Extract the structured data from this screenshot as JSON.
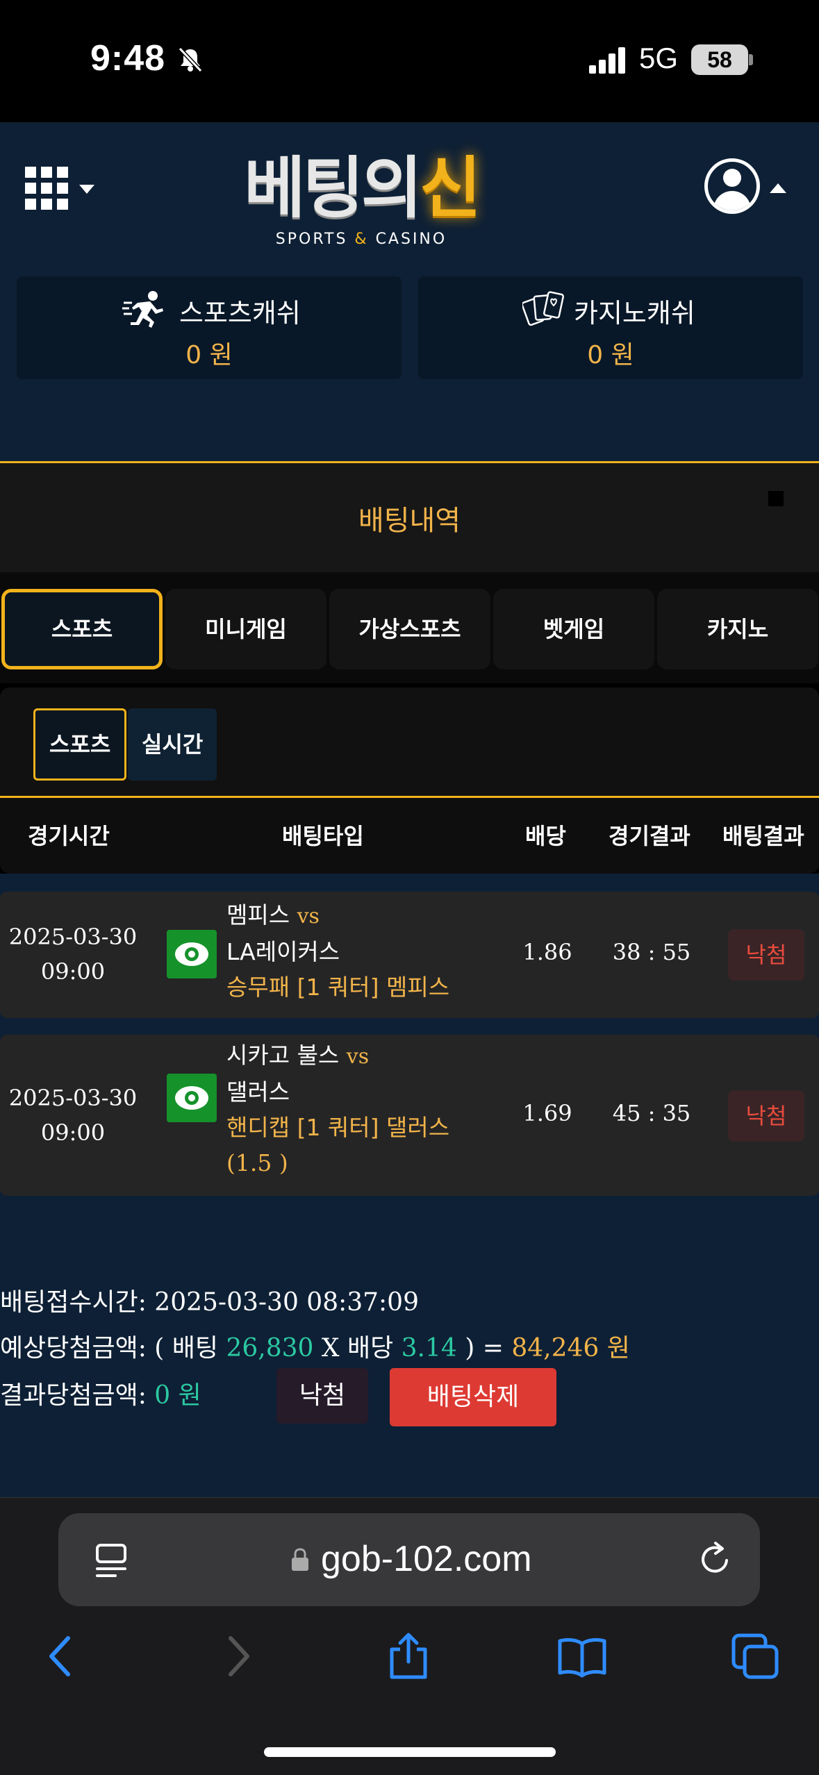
{
  "status_bar": {
    "time": "9:48",
    "network": "5G",
    "battery": "58"
  },
  "header": {
    "logo_main_white": "베팅의",
    "logo_main_gold": "신",
    "logo_sub_left": "SPORTS ",
    "logo_sub_amp": "&",
    "logo_sub_right": " CASINO"
  },
  "wallets": [
    {
      "label": "스포츠캐쉬",
      "value": "0 원",
      "icon": "sports-runner-icon"
    },
    {
      "label": "카지노캐쉬",
      "value": "0 원",
      "icon": "playing-cards-icon"
    }
  ],
  "page_title": "배팅내역",
  "categories": [
    "스포츠",
    "미니게임",
    "가상스포츠",
    "벳게임",
    "카지노"
  ],
  "active_category": "스포츠",
  "sub_tabs": [
    "스포츠",
    "실시간"
  ],
  "active_sub_tab": "스포츠",
  "table": {
    "headers": [
      "경기시간",
      "배팅타입",
      "배당",
      "경기결과",
      "배팅결과"
    ],
    "rows": [
      {
        "date": "2025-03-30",
        "time": "09:00",
        "home": "멤피스",
        "vs": "vs",
        "away": "LA레이커스",
        "bet_type": "승무패 [1 쿼터] 멤피스",
        "bet_type_extra": "",
        "odds": "1.86",
        "score": "38 : 55",
        "result": "낙첨"
      },
      {
        "date": "2025-03-30",
        "time": "09:00",
        "home": "시카고 불스",
        "vs": "vs",
        "away": "댈러스",
        "bet_type": "핸디캡 [1 쿼터] 댈러스",
        "bet_type_extra": "(1.5 )",
        "odds": "1.69",
        "score": "45 : 35",
        "result": "낙첨"
      }
    ]
  },
  "summary": {
    "received_label": "배팅접수시간: ",
    "received_value": "2025-03-30 08:37:09",
    "expected_label": "예상당첨금액: ( 배팅 ",
    "bet_amount": "26,830",
    "x_label": " X 배당 ",
    "total_odds": "3.14",
    "close_eq": " ) = ",
    "expected_win": "84,246 원",
    "result_label": "결과당첨금액: ",
    "result_value": "0 원",
    "status_button": "낙첨",
    "delete_button": "배팅삭제"
  },
  "browser": {
    "url": "gob-102.com"
  },
  "colors": {
    "accent_gold": "#f2b21b",
    "header_bg": "#0e2035",
    "lost_red": "#e84c3d",
    "value_green": "#2cc9a2",
    "delete_red": "#dd3a33"
  }
}
